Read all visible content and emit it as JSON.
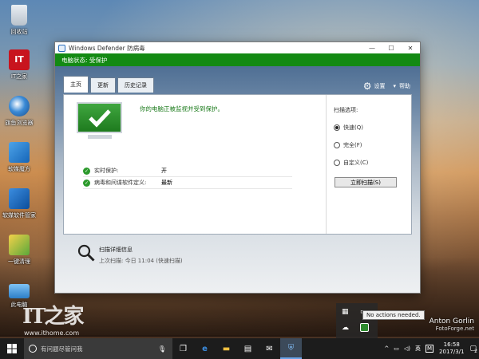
{
  "desktop": {
    "icons": [
      {
        "label": "回收站",
        "icon": "recycle-bin-icon"
      },
      {
        "label": "IT之家",
        "icon": "ithome-icon"
      },
      {
        "label": "旗鱼浏览器",
        "icon": "browser-icon"
      },
      {
        "label": "软媒魔方",
        "icon": "cube-icon"
      },
      {
        "label": "软媒软件管家",
        "icon": "software-manager-icon"
      },
      {
        "label": "一键清理",
        "icon": "cleanup-icon"
      },
      {
        "label": "此电脑",
        "icon": "computer-icon"
      }
    ],
    "watermark_big": "IT之家",
    "watermark_url": "www.ithome.com",
    "author": "Anton Gorlin",
    "author_site": "FotoForge.net"
  },
  "window": {
    "title": "Windows Defender 防病毒",
    "status": "电脑状态: 受保护",
    "tabs": [
      {
        "label": "主页",
        "active": true
      },
      {
        "label": "更新",
        "active": false
      },
      {
        "label": "历史记录",
        "active": false
      }
    ],
    "settings_label": "设置",
    "help_label": "帮助",
    "headline": "你的电脑正被监视并受到保护。",
    "rows": [
      {
        "name": "实时保护:",
        "value": "开"
      },
      {
        "name": "病毒和间谍软件定义:",
        "value": "最新"
      }
    ],
    "scan_options_title": "扫描选项:",
    "scan_options": [
      {
        "label": "快速(Q)",
        "selected": true
      },
      {
        "label": "完全(F)",
        "selected": false
      },
      {
        "label": "自定义(C)",
        "selected": false
      }
    ],
    "scan_button": "立即扫描(S)",
    "details_title": "扫描详细信息",
    "last_scan": "上次扫描: 今日 11:04 (快速扫描)",
    "accent_green": "#138a13"
  },
  "tray": {
    "tooltip": "No actions needed.",
    "ime": "英",
    "clock_time": "16:58",
    "clock_date": "2017/3/1",
    "notifications": "2"
  },
  "taskbar": {
    "search_placeholder": "有问题尽管问我"
  }
}
